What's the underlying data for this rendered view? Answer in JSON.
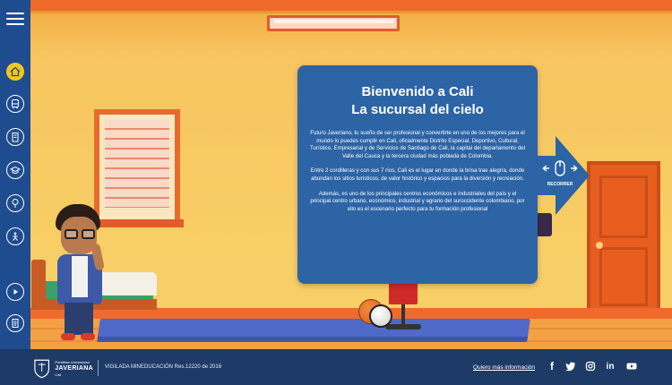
{
  "rail": {
    "items": [
      {
        "name": "home-icon"
      },
      {
        "name": "bus-icon"
      },
      {
        "name": "building-icon"
      },
      {
        "name": "graduation-cap-icon"
      },
      {
        "name": "tree-icon"
      },
      {
        "name": "person-slide-icon"
      },
      {
        "name": "play-icon"
      },
      {
        "name": "document-icon"
      }
    ],
    "active_color": "#f3c51c",
    "background": "#1f4c8f"
  },
  "card": {
    "title_line1": "Bienvenido a Cali",
    "title_line2": "La sucursal del cielo",
    "paragraph1": "Futuro Javeriano, tu sueño de ser profesional y convertirte en uno de los mejores para el mundo lo puedes cumplir en Cali, oficialmente Distrito Especial, Deportivo, Cultural, Turístico, Empresarial y de Servicios de Santiago de Cali, la capital del departamento del Valle del Cauca y la tercera ciudad más poblada de Colombia.",
    "paragraph2": "Entre 2 cordilleras y con sus 7 ríos, Cali es el lugar en donde la brisa trae alegría, donde abundan los sitios turísticos, de valor histórico y espacios para la diversión y recreación.",
    "paragraph3": "Además, es uno de los principales centros económicos e industriales del país y el principal centro urbano, económico, industrial y agrario del suroccidente colombiano, por ello es el escenario perfecto para tu formación profesional",
    "background": "#2c64a6"
  },
  "scroll_hint": {
    "label": "RECORRER",
    "icon": "mouse-icon"
  },
  "footer": {
    "logo_line1": "Pontificia Universidad",
    "logo_line2": "JAVERIANA",
    "logo_line3": "Cali",
    "vigilada": "VIGILADA MINEDUCACIÓN Res.12220 de 2016",
    "more_info": "Quiero más información",
    "social": [
      {
        "name": "facebook-icon",
        "glyph": "f"
      },
      {
        "name": "twitter-icon"
      },
      {
        "name": "instagram-icon"
      },
      {
        "name": "linkedin-icon",
        "glyph": "in"
      },
      {
        "name": "youtube-icon"
      }
    ],
    "background": "#1e3a67"
  }
}
